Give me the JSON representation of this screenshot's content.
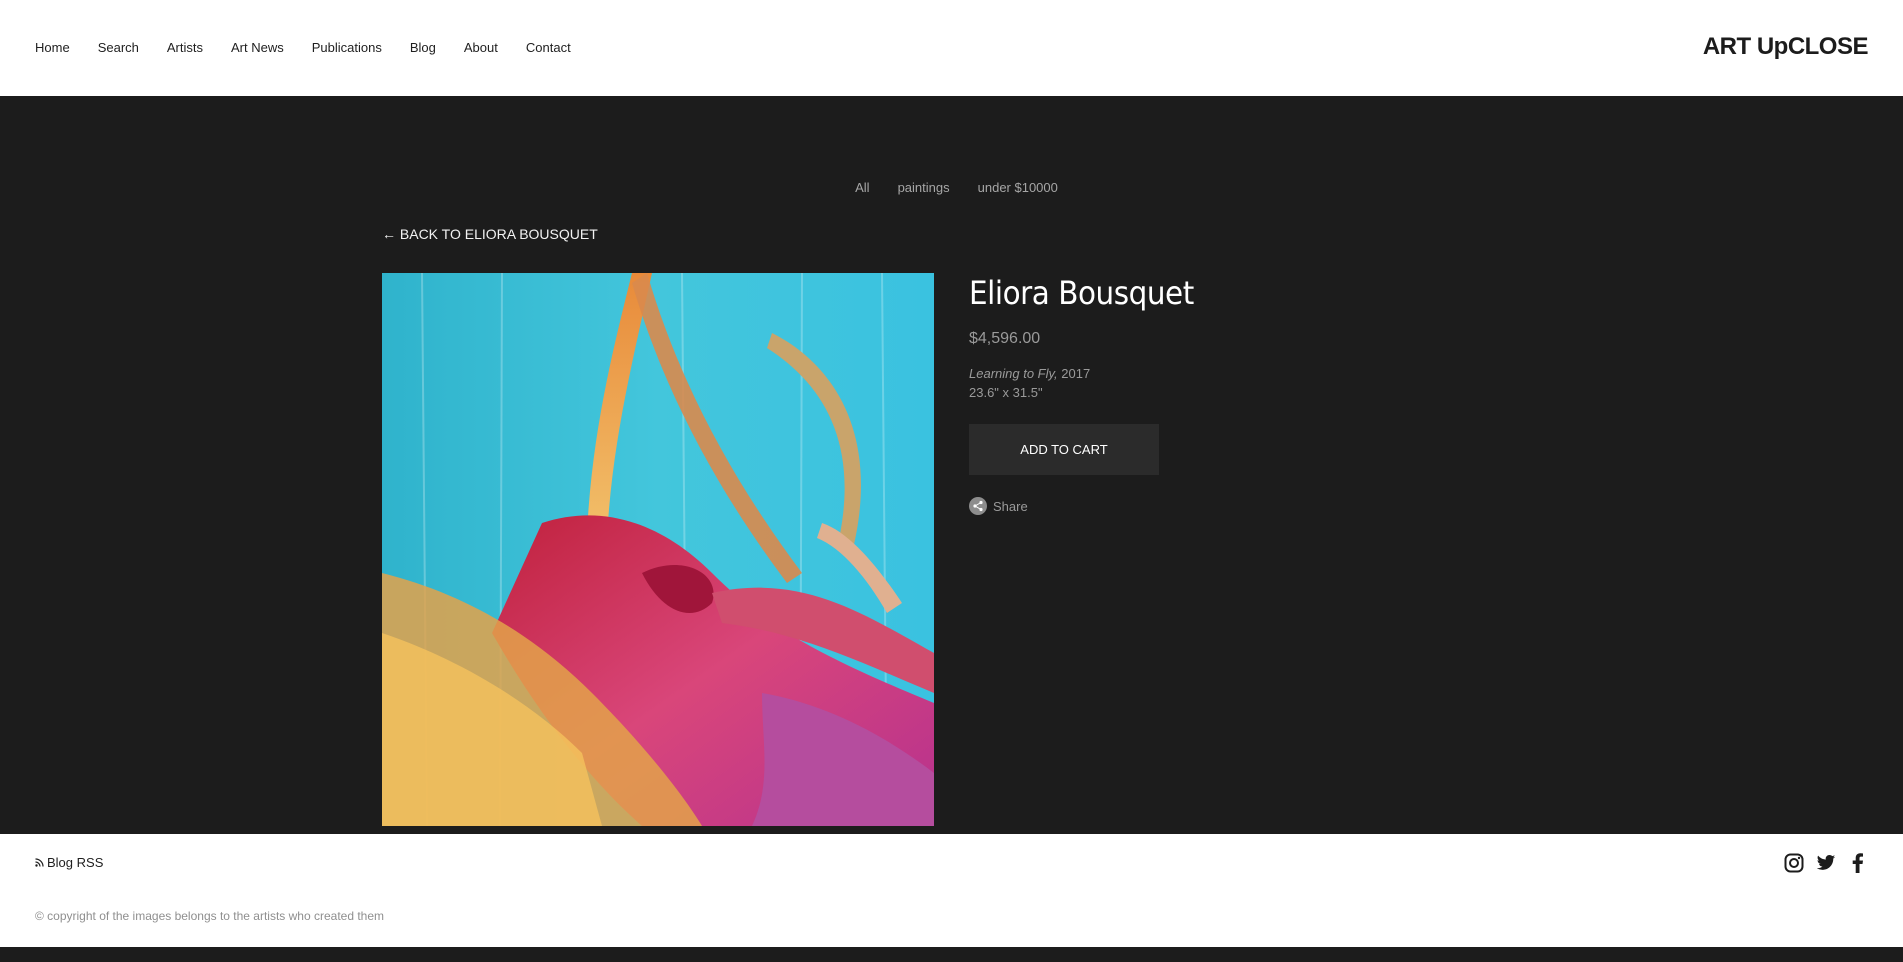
{
  "header": {
    "nav": [
      "Home",
      "Search",
      "Artists",
      "Art News",
      "Publications",
      "Blog",
      "About",
      "Contact"
    ],
    "logo": "ART UpCLOSE"
  },
  "filters": [
    "All",
    "paintings",
    "under $10000"
  ],
  "back_link": "← BACK TO ELIORA BOUSQUET",
  "artwork": {
    "artist": "Eliora Bousquet",
    "price": "$4,596.00",
    "title": "Learning to Fly,",
    "year": "2017",
    "dimensions": "23.6\" x 31.5\"",
    "add_to_cart": "ADD TO CART",
    "share": "Share"
  },
  "footer": {
    "rss": "Blog RSS",
    "copyright": "© copyright of the images belongs to the artists who created them",
    "social_icons": [
      "instagram-icon",
      "twitter-icon",
      "facebook-icon"
    ]
  },
  "colors": {
    "background": "#1c1c1c",
    "header": "#ffffff",
    "button": "#2b2b2b",
    "muted_text": "#9a9a9a"
  }
}
